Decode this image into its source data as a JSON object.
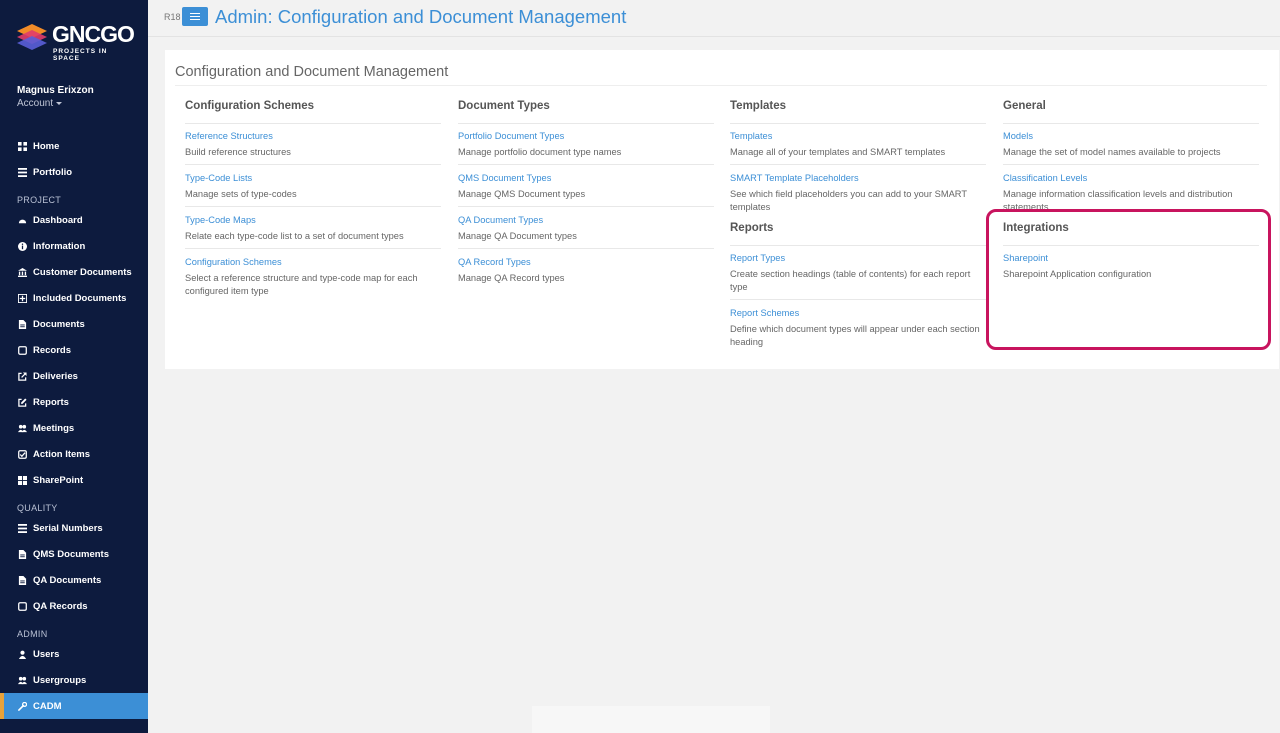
{
  "brand": {
    "logo_main": "GNC",
    "logo_go": "GO",
    "logo_sub": "PROJECTS IN SPACE"
  },
  "user": {
    "name": "Magnus Erixzon",
    "account": "Account"
  },
  "sidebar": {
    "top": [
      {
        "label": "Home",
        "icon": "grid-icon"
      },
      {
        "label": "Portfolio",
        "icon": "list-icon"
      }
    ],
    "project_label": "PROJECT",
    "project": [
      {
        "label": "Dashboard",
        "icon": "dashboard-icon"
      },
      {
        "label": "Information",
        "icon": "info-icon"
      },
      {
        "label": "Customer Documents",
        "icon": "bank-icon"
      },
      {
        "label": "Included Documents",
        "icon": "plus-square-icon"
      },
      {
        "label": "Documents",
        "icon": "file-icon"
      },
      {
        "label": "Records",
        "icon": "square-icon"
      },
      {
        "label": "Deliveries",
        "icon": "external-link-icon"
      },
      {
        "label": "Reports",
        "icon": "edit-icon"
      },
      {
        "label": "Meetings",
        "icon": "users-icon"
      },
      {
        "label": "Action Items",
        "icon": "check-square-icon"
      },
      {
        "label": "SharePoint",
        "icon": "windows-icon"
      }
    ],
    "quality_label": "QUALITY",
    "quality": [
      {
        "label": "Serial Numbers",
        "icon": "list-icon"
      },
      {
        "label": "QMS Documents",
        "icon": "file-icon"
      },
      {
        "label": "QA Documents",
        "icon": "file-icon"
      },
      {
        "label": "QA Records",
        "icon": "square-icon"
      }
    ],
    "admin_label": "ADMIN",
    "admin": [
      {
        "label": "Users",
        "icon": "user-icon"
      },
      {
        "label": "Usergroups",
        "icon": "users-icon"
      },
      {
        "label": "CADM",
        "icon": "wrench-icon",
        "active": true
      }
    ]
  },
  "header": {
    "release": "R18",
    "title": "Admin: Configuration and Document Management"
  },
  "panel": {
    "title": "Configuration and Document Management",
    "columns": [
      {
        "heading": "Configuration Schemes",
        "entries": [
          {
            "link": "Reference Structures",
            "desc": "Build reference structures"
          },
          {
            "link": "Type-Code Lists",
            "desc": "Manage sets of type-codes"
          },
          {
            "link": "Type-Code Maps",
            "desc": "Relate each type-code list to a set of document types"
          },
          {
            "link": "Configuration Schemes",
            "desc": "Select a reference structure and type-code map for each configured item type"
          }
        ]
      },
      {
        "heading": "Document Types",
        "entries": [
          {
            "link": "Portfolio Document Types",
            "desc": "Manage portfolio document type names"
          },
          {
            "link": "QMS Document Types",
            "desc": "Manage QMS Document types"
          },
          {
            "link": "QA Document Types",
            "desc": "Manage QA Document types"
          },
          {
            "link": "QA Record Types",
            "desc": "Manage QA Record types"
          }
        ]
      },
      {
        "heading": "Templates",
        "entries": [
          {
            "link": "Templates",
            "desc": "Manage all of your templates and SMART templates"
          },
          {
            "link": "SMART Template Placeholders",
            "desc": "See which field placeholders you can add to your SMART templates"
          }
        ]
      },
      {
        "heading": "Reports",
        "entries": [
          {
            "link": "Report Types",
            "desc": "Create section headings (table of contents) for each report type"
          },
          {
            "link": "Report Schemes",
            "desc": "Define which document types will appear under each section heading"
          }
        ]
      },
      {
        "heading": "General",
        "entries": [
          {
            "link": "Models",
            "desc": "Manage the set of model names available to projects"
          },
          {
            "link": "Classification Levels",
            "desc": "Manage information classification levels and distribution statements"
          }
        ]
      },
      {
        "heading": "Integrations",
        "entries": [
          {
            "link": "Sharepoint",
            "desc": "Sharepoint Application configuration"
          }
        ]
      }
    ]
  },
  "colors": {
    "sidebar": "#0d1b3e",
    "accent": "#3c8fd6",
    "highlight": "#c8145e",
    "active_marker": "#e8a23a"
  }
}
